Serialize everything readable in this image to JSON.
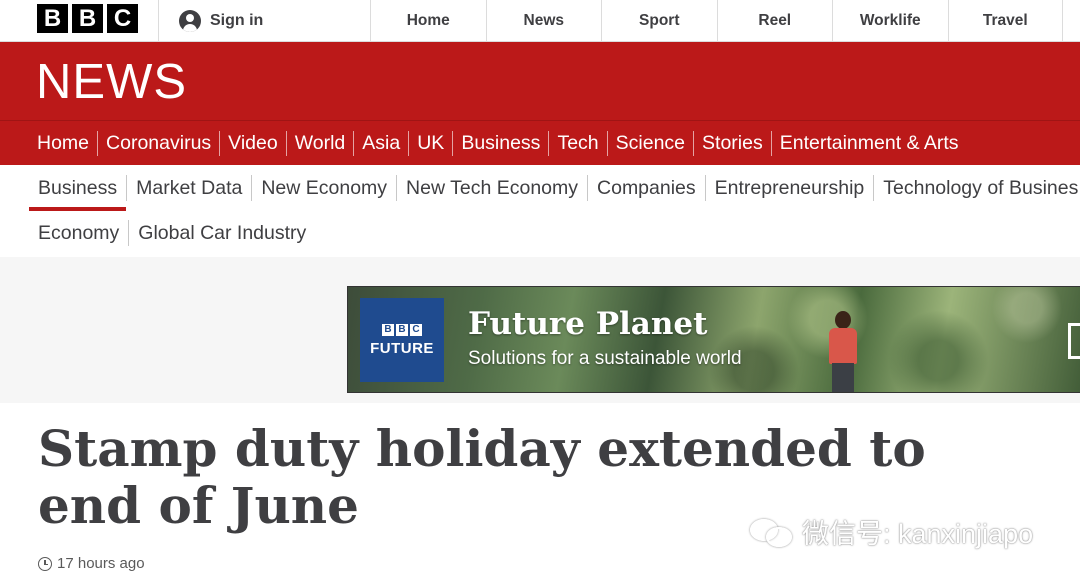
{
  "global_bar": {
    "logo_letters": [
      "B",
      "B",
      "C"
    ],
    "signin_label": "Sign in",
    "nav": [
      "Home",
      "News",
      "Sport",
      "Reel",
      "Worklife",
      "Travel"
    ]
  },
  "masthead": {
    "title": "NEWS",
    "brand_color": "#bb1919"
  },
  "section_nav": [
    "Home",
    "Coronavirus",
    "Video",
    "World",
    "Asia",
    "UK",
    "Business",
    "Tech",
    "Science",
    "Stories",
    "Entertainment & Arts"
  ],
  "sub_nav": {
    "row1": [
      "Business",
      "Market Data",
      "New Economy",
      "New Tech Economy",
      "Companies",
      "Entrepreneurship",
      "Technology of Busines"
    ],
    "row2": [
      "Economy",
      "Global Car Industry"
    ],
    "active": "Business"
  },
  "promo": {
    "badge_letters": [
      "B",
      "B",
      "C"
    ],
    "badge_label": "FUTURE",
    "title": "Future Planet",
    "subtitle": "Solutions for a sustainable world"
  },
  "article": {
    "headline": "Stamp duty holiday extended to end of June",
    "timestamp": "17 hours ago"
  },
  "watermark": {
    "text": "微信号: kanxinjiapo"
  }
}
